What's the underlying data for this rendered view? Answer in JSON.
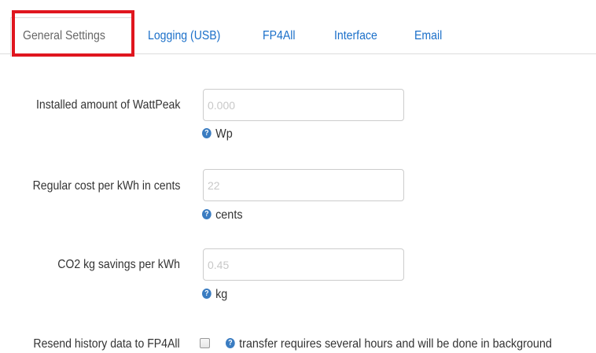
{
  "tabs": [
    {
      "label": "General Settings"
    },
    {
      "label": "Logging (USB)"
    },
    {
      "label": "FP4All"
    },
    {
      "label": "Interface"
    },
    {
      "label": "Email"
    }
  ],
  "active_tab": "General Settings",
  "fields": {
    "wattpeak": {
      "label": "Installed amount of WattPeak",
      "placeholder": "0.000",
      "help": "Wp"
    },
    "cost": {
      "label": "Regular cost per kWh in cents",
      "placeholder": "22",
      "help": "cents"
    },
    "co2": {
      "label": "CO2 kg savings per kWh",
      "placeholder": "0.45",
      "help": "kg"
    },
    "resend": {
      "label": "Resend history data to FP4All",
      "checked": false,
      "help": "transfer requires several hours and will be done in background"
    }
  },
  "help_icon": {
    "glyph": "?",
    "icon": "help-icon",
    "color": "#3a7cc1"
  },
  "colors": {
    "link": "#1a6fc9",
    "highlight": "#e0161e"
  }
}
